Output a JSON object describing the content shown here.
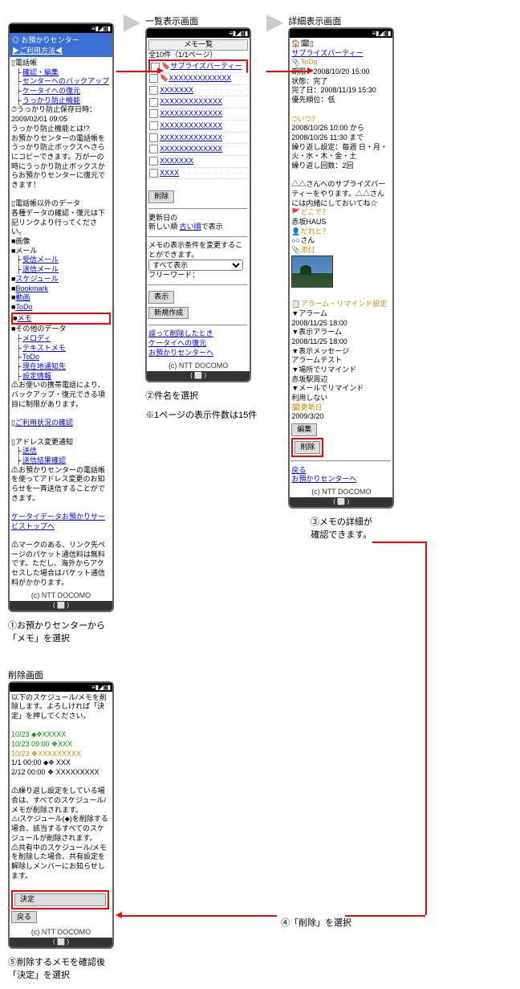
{
  "status_bar": "≡▮◢▯▮",
  "screen1": {
    "header_title": "一覧表示画面",
    "title_icon": "◎",
    "title": "お預かりセンター",
    "usage": "▶ご利用方法◀",
    "sec_phone": "電話帳",
    "l_confirm_edit": "確認・編集",
    "l_backup_center": "センターへのバックアップ",
    "l_restore_ketai": "ケータイへの復元",
    "l_ukkari": "うっかり防止機能",
    "ukkari_time_label": "うっかり防止保存日時：",
    "ukkari_time": "2009/02/01 09:05",
    "ukkari_desc": "うっかり防止機能とは!?\nお預かりセンターの電話帳をうっかり防止ボックスへさらにコピーできます。万が一の時にうっかり防止ボックスからお預かりセンターに復元できます！",
    "sec_other": "電話帳以外のデータ",
    "other_desc": "各種データの確認・復元は下記リンクより行ってください。",
    "i_image": "■画像",
    "i_mail": "■メール",
    "l_recv_mail": "受信メール",
    "l_send_mail": "送信メール",
    "l_schedule": "スケジュール",
    "l_bookmark": "Bookmark",
    "l_movie": "動画",
    "l_todo": "ToDo",
    "l_memo": "メモ",
    "i_other_data": "■その他のデータ",
    "l_melody": "メロディ",
    "l_textmemo": "テキストメモ",
    "l_todo2": "ToDo",
    "l_location": "現在地通知先",
    "l_settings": "設定情報",
    "restore_note": "お使いの携帯電話により、バックアップ・復元できる項目に制限があります。",
    "l_usage_status": "ご利用状況の確認",
    "sec_addr": "アドレス変更通知",
    "l_send": "送信",
    "l_result": "送信結果確認",
    "addr_desc": "お預かりセンターの電話帳を使ってアドレス変更のお知らせを一斉送信することができます。",
    "l_ketai_data": "ケータイデータお預かりサービストップへ",
    "mark_note": "マークのある、リンク先ページのパケット通信料は無料です。ただし、海外からアクセスした場合はパケット通信料がかかります。",
    "copyright": "(c) NTT DOCOMO",
    "caption": "①お預かりセンターから\n「メモ」を選択"
  },
  "screen2": {
    "header_title": "一覧表示画面",
    "sub_title": "メモ一覧",
    "count_info": "全10件（1/1ページ）",
    "item_highlight": "サプライズパーティー",
    "item_x": "XXXXXXXXXXXXX",
    "item_xs": "XXXXXXX",
    "item_xxs": "XXXX",
    "btn_delete": "削除",
    "sort_label1": "更新日の",
    "sort_label2": "新しい順",
    "sort_link": "古い順",
    "sort_label3": "で表示",
    "filter_label": "メモの表示条件を変更することができます。",
    "select_opt": "すべて表示",
    "freeword": "フリーワード：",
    "btn_show": "表示",
    "btn_new": "新規作成",
    "l_deleted": "誤って削除したとき",
    "l_restore": "ケータイへの復元",
    "l_center": "お預かりセンターへ",
    "copyright": "(c) NTT DOCOMO",
    "caption": "②件名を選択",
    "note": "※1ページの表示件数は15件"
  },
  "screen3": {
    "header_title": "詳細表示画面",
    "title": "サプライズパーティー",
    "todo": "ToDo",
    "deadline": "期限：2008/10/20 15:00",
    "status": "状態：完了",
    "completed": "完了日：2008/11/19 15:30",
    "priority": "優先順位：低",
    "when_q": "いつ？",
    "when1": "2008/10/26 10:00 から",
    "when2": "2008/10/26 11:30 まで",
    "repeat": "繰り返し設定：毎週 日・月・火・水・木・金・土",
    "repeat_count": "繰り返し回数：2回",
    "desc": "△△さんへのサプライズパーティーをやります。△△さんには内緒にしておいてね☆",
    "where_q": "どこで？",
    "where": "赤坂HAUS",
    "who_q": "だれと？",
    "who": "○○さん",
    "attach": "添付",
    "alarm_header": "アラーム・リマインド設定",
    "alarm1": "▼アラーム",
    "alarm1_time": "2008/11/25 18:00",
    "alarm2": "▼表示アラーム",
    "alarm2_time": "2008/11/25 18:00",
    "alarm3": "▼表示メッセージ",
    "alarm3_msg": "アラームテスト",
    "alarm4": "▼場所でリマインド",
    "alarm4_loc": "赤坂駅周辺",
    "alarm5": "▼メールでリマインド",
    "alarm5_val": "利用しない",
    "update_label": "更新日",
    "update_date": "2009/3/20",
    "btn_edit": "編集",
    "btn_delete": "削除",
    "l_back": "戻る",
    "l_center": "お預かりセンターへ",
    "copyright": "(c) NTT DOCOMO",
    "caption": "③メモの詳細が\n確認できます。"
  },
  "screen4": {
    "header_title": "削除画面",
    "confirm_msg": "以下のスケジュール/メモを削除します。よろしければ「決定」を押してください。",
    "row1": "10/23 ⬥❖XXXXX",
    "row2": "10/23 09:00 ❖XXX",
    "row3": "10/23 ❖XXXXXXXXX",
    "row4": " 1/1  00:00 ⬥❖ XXX",
    "row5": " 2/12 00:00 ❖ XXXXXXXXX",
    "note1": "繰り返し設定をしている場合は、すべてのスケジュール/メモが削除されます。",
    "note2": "iスケジュール(⬥)を削除する場合、該当するすべてのスケジュールが削除されます。",
    "note3": "共有中のスケジュール/メモを削除した場合、共有設定を解除しメンバーにお知らせします。",
    "btn_ok": "決定",
    "btn_back": "戻る",
    "copyright": "(c) NTT DOCOMO",
    "caption": "⑤削除するメモを確認後\n「決定」を選択",
    "step4_label": "④「削除」を選択"
  }
}
